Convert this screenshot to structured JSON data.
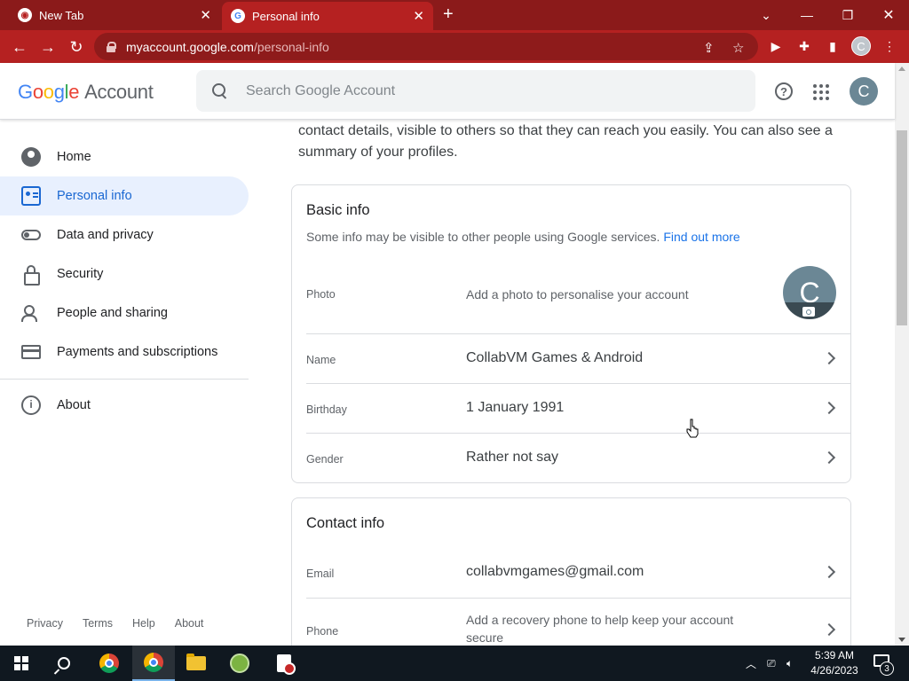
{
  "browser": {
    "tabs": [
      {
        "title": "New Tab"
      },
      {
        "title": "Personal info"
      }
    ],
    "url_host": "myaccount.google.com",
    "url_path": "/personal-info",
    "profile_initial": "C",
    "theme_color": "#b52121"
  },
  "header": {
    "logo_letters": [
      "G",
      "o",
      "o",
      "g",
      "l",
      "e"
    ],
    "logo_suffix": "Account",
    "search_placeholder": "Search Google Account",
    "avatar_initial": "C",
    "help_glyph": "?"
  },
  "sidebar": {
    "items": [
      {
        "label": "Home",
        "icon": "account-circle-icon"
      },
      {
        "label": "Personal info",
        "icon": "person-card-icon",
        "active": true
      },
      {
        "label": "Data and privacy",
        "icon": "toggle-icon"
      },
      {
        "label": "Security",
        "icon": "lock-icon"
      },
      {
        "label": "People and sharing",
        "icon": "people-icon"
      },
      {
        "label": "Payments and subscriptions",
        "icon": "credit-card-icon"
      },
      {
        "label": "About",
        "icon": "info-icon"
      }
    ],
    "footer": [
      "Privacy",
      "Terms",
      "Help",
      "About"
    ]
  },
  "main": {
    "intro_text": "contact details, visible to others so that they can reach you easily. You can also see a summary of your profiles.",
    "basic_info": {
      "title": "Basic info",
      "subtitle": "Some info may be visible to other people using Google services.",
      "subtitle_link": "Find out more",
      "rows": [
        {
          "label": "Photo",
          "value": "Add a photo to personalise your account",
          "avatar_initial": "C"
        },
        {
          "label": "Name",
          "value": "CollabVM Games & Android"
        },
        {
          "label": "Birthday",
          "value": "1 January 1991"
        },
        {
          "label": "Gender",
          "value": "Rather not say"
        }
      ]
    },
    "contact_info": {
      "title": "Contact info",
      "rows": [
        {
          "label": "Email",
          "value": "collabvmgames@gmail.com"
        },
        {
          "label": "Phone",
          "value": "Add a recovery phone to help keep your account secure"
        }
      ]
    }
  },
  "taskbar": {
    "time": "5:39 AM",
    "date": "4/26/2023",
    "notification_count": "3"
  }
}
